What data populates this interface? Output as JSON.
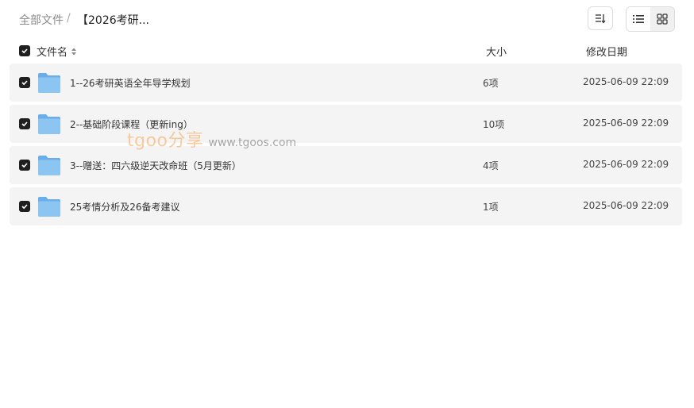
{
  "breadcrumb": {
    "root": "全部文件",
    "separator": "/",
    "current": "【2026考研..."
  },
  "toolbar": {
    "sort_icon": "sort-icon",
    "list_view_icon": "list-view-icon",
    "grid_view_icon": "grid-view-icon"
  },
  "columns": {
    "name": "文件名",
    "size": "大小",
    "date": "修改日期"
  },
  "rows": [
    {
      "name": "1--26考研英语全年导学规划",
      "size": "6项",
      "date": "2025-06-09 22:09"
    },
    {
      "name": "2--基础阶段课程（更新ing）",
      "size": "10项",
      "date": "2025-06-09 22:09"
    },
    {
      "name": "3--赠送：四六级逆天改命班（5月更新）",
      "size": "4项",
      "date": "2025-06-09 22:09"
    },
    {
      "name": "25考情分析及26备考建议",
      "size": "1项",
      "date": "2025-06-09 22:09"
    }
  ],
  "watermark": {
    "brand": "tgoo分享",
    "url": "www.tgoos.com"
  },
  "colors": {
    "row_bg": "#f4f4f5",
    "checkbox": "#1f1f1f",
    "folder": "#7cb8ef"
  }
}
